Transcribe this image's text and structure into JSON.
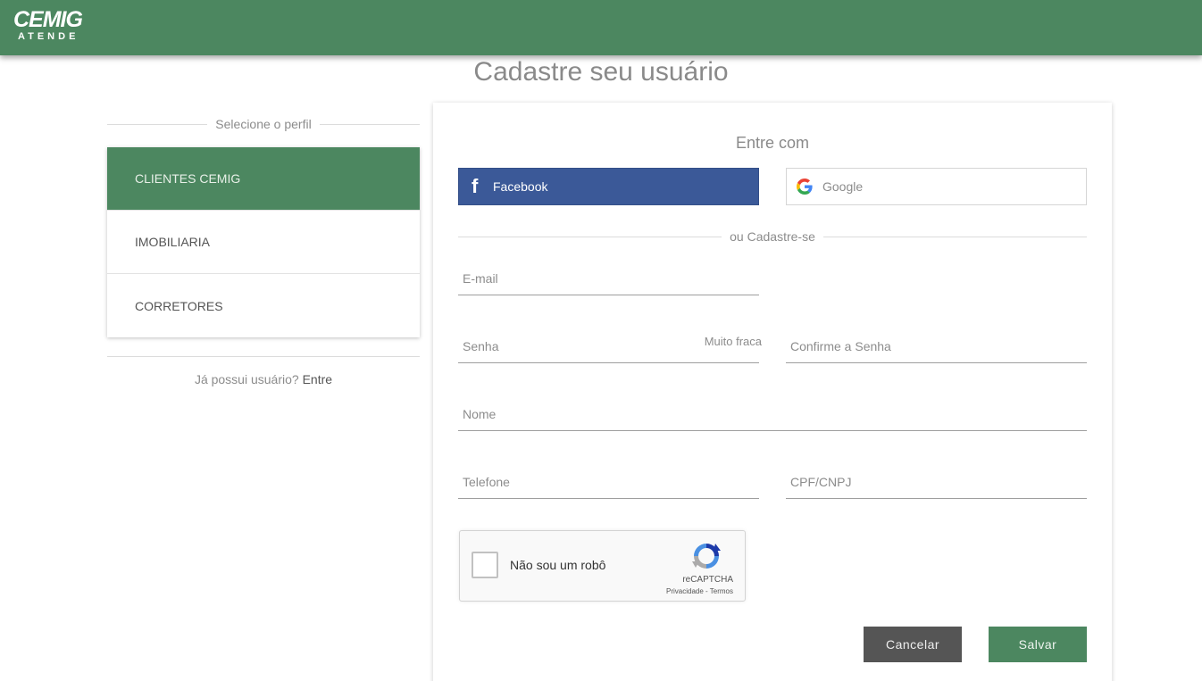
{
  "header": {
    "logo_main": "CEMIG",
    "logo_sub": "ATENDE",
    "bg_color": "#4c8760"
  },
  "page_title": "Cadastre seu usuário",
  "profile": {
    "section_label": "Selecione o perfil",
    "items": [
      {
        "label": "CLIENTES CEMIG",
        "selected": true
      },
      {
        "label": "IMOBILIARIA",
        "selected": false
      },
      {
        "label": "CORRETORES",
        "selected": false
      }
    ],
    "login_prompt": "Já possui usuário?",
    "login_link": "Entre"
  },
  "form": {
    "social_title": "Entre com",
    "facebook_label": "Facebook",
    "facebook_icon": "facebook-f-icon",
    "google_label": "Google",
    "google_icon": "google-g-icon",
    "divider_label": "ou Cadastre-se",
    "email_placeholder": "E-mail",
    "password_placeholder": "Senha",
    "password_strength": "Muito fraca",
    "confirm_placeholder": "Confirme a Senha",
    "name_placeholder": "Nome",
    "phone_placeholder": "Telefone",
    "cpf_placeholder": "CPF/CNPJ",
    "captcha": {
      "label": "Não sou um robô",
      "brand": "reCAPTCHA",
      "privacy": "Privacidade",
      "separator": " - ",
      "terms": "Termos"
    },
    "cancel_label": "Cancelar",
    "save_label": "Salvar"
  },
  "colors": {
    "primary_green": "#4c8760",
    "facebook_blue": "#3b5998",
    "cancel_gray": "#555555"
  }
}
